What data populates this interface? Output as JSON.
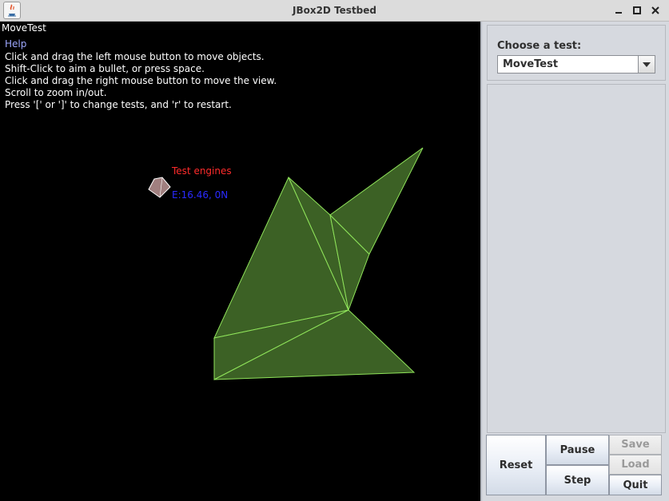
{
  "window": {
    "title": "JBox2D Testbed",
    "controls": [
      "minimize",
      "maximize",
      "close"
    ]
  },
  "canvas": {
    "current_test": "MoveTest",
    "help": {
      "title": "Help",
      "lines": [
        "Click and drag the left mouse button to move objects.",
        "Shift-Click to aim a bullet, or press space.",
        "Click and drag the right mouse button to move the view.",
        "Scroll to zoom in/out.",
        "Press '[' or ']' to change tests, and 'r' to restart."
      ]
    },
    "annotations": {
      "engines_label": "Test engines",
      "energy_readout": "E:16.46, 0N"
    },
    "colors": {
      "background": "#000000",
      "shape_fill": "#3c6125",
      "shape_stroke": "#8fe35a",
      "engines_label": "#ff2b2b",
      "energy_readout": "#2a2aff",
      "small_box": "#a07f7f"
    }
  },
  "sidebar": {
    "choose_label": "Choose a test:",
    "selected_test": "MoveTest",
    "buttons": {
      "reset": "Reset",
      "pause": "Pause",
      "step": "Step",
      "save": "Save",
      "load": "Load",
      "quit": "Quit"
    }
  }
}
